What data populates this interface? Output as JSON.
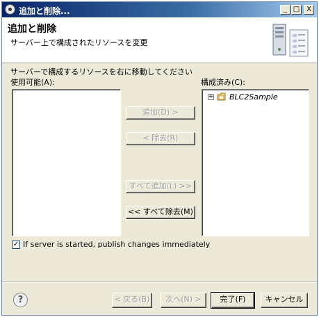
{
  "window": {
    "title": "追加と削除...",
    "controls": {
      "minimize": "_",
      "maximize": "□",
      "close": "X"
    }
  },
  "header": {
    "title": "追加と削除",
    "description": "サーバー上で構成されたリソースを変更",
    "graphic_icon": "server-wizard-icon"
  },
  "instruction": "サーバーで構成するリソースを右に移動してください",
  "available": {
    "label": "使用可能(A):",
    "items": []
  },
  "configured": {
    "label": "構成済み(C):",
    "items": [
      {
        "label": "BLC2Sample",
        "expander": "+",
        "icon": "project-folder-icon"
      }
    ]
  },
  "buttons": {
    "add": "追加(D) >",
    "remove": "< 除去(R)",
    "add_all": "すべて追加(L) >>",
    "remove_all": "<< すべて除去(M)",
    "back": "< 戻る(B)",
    "next": "次へ(N) >",
    "finish": "完了(F)",
    "cancel": "キャンセル"
  },
  "publish_option": {
    "checked": true,
    "check_mark": "✓",
    "label": "If server is started, publish changes immediately"
  },
  "help_icon": "?"
}
